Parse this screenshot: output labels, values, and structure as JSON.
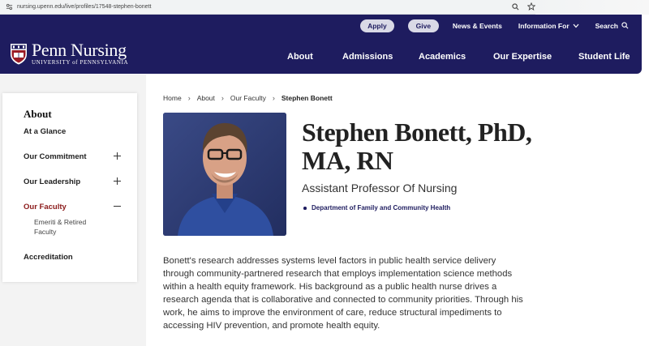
{
  "browser": {
    "url": "nursing.upenn.edu/live/profiles/17548-stephen-bonett",
    "icons": [
      "site-settings-icon",
      "zoom-icon",
      "bookmark-star-icon"
    ]
  },
  "header": {
    "logo": {
      "main": "Penn Nursing",
      "sub": "UNIVERSITY of PENNSYLVANIA"
    },
    "utility": {
      "apply": "Apply",
      "give": "Give",
      "news": "News & Events",
      "info": "Information For",
      "search": "Search"
    },
    "nav": [
      "About",
      "Admissions",
      "Academics",
      "Our Expertise",
      "Student Life"
    ],
    "colors": {
      "navy": "#1e1c5f",
      "pill": "#d9d9e6"
    }
  },
  "sidebar": {
    "title": "About",
    "items": [
      {
        "label": "At a Glance"
      },
      {
        "label": "Our Commitment",
        "toggle": "plus"
      },
      {
        "label": "Our Leadership",
        "toggle": "plus"
      },
      {
        "label": "Our Faculty",
        "toggle": "minus",
        "active": true
      },
      {
        "label": "Accreditation"
      }
    ],
    "sub_item": "Emeriti & Retired Faculty",
    "colors": {
      "active": "#8b1a1a"
    }
  },
  "breadcrumb": [
    "Home",
    "About",
    "Our Faculty",
    "Stephen Bonett"
  ],
  "profile": {
    "name": "Stephen Bonett, PhD, MA, RN",
    "role": "Assistant Professor Of Nursing",
    "department": "Department of Family and Community Health",
    "bio": "Bonett's research addresses systems level factors in public health service delivery through community-partnered research that employs implementation science methods within a health equity framework. His background as a public health nurse drives a research agenda that is collaborative and connected to community priorities. Through his work, he aims to improve the environment of care, reduce structural impediments to accessing HIV prevention, and promote health equity."
  }
}
